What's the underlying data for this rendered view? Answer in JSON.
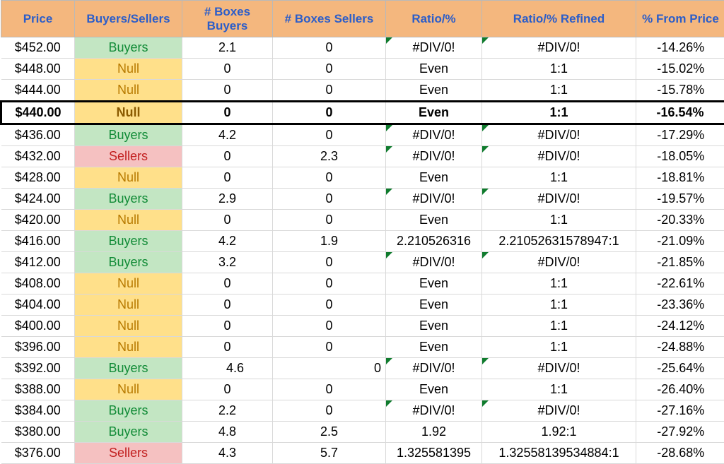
{
  "headers": {
    "price": "Price",
    "bs": "Buyers/Sellers",
    "boxes_buyers": "# Boxes Buyers",
    "boxes_sellers": "# Boxes Sellers",
    "ratio": "Ratio/%",
    "ratio_refined": "Ratio/% Refined",
    "pct_from_price": "% From Price"
  },
  "rows": [
    {
      "price": "$452.00",
      "bs": "Buyers",
      "bs_kind": "buyers",
      "bb": "2.1",
      "bsell": "0",
      "ratio": "#DIV/0!",
      "ratio_flag": true,
      "ratioref": "#DIV/0!",
      "ratioref_flag": true,
      "pct": "-14.26%",
      "hl": false
    },
    {
      "price": "$448.00",
      "bs": "Null",
      "bs_kind": "null",
      "bb": "0",
      "bsell": "0",
      "ratio": "Even",
      "ratio_flag": false,
      "ratioref": "1:1",
      "ratioref_flag": false,
      "pct": "-15.02%",
      "hl": false
    },
    {
      "price": "$444.00",
      "bs": "Null",
      "bs_kind": "null",
      "bb": "0",
      "bsell": "0",
      "ratio": "Even",
      "ratio_flag": false,
      "ratioref": "1:1",
      "ratioref_flag": false,
      "pct": "-15.78%",
      "hl": false
    },
    {
      "price": "$440.00",
      "bs": "Null",
      "bs_kind": "null",
      "bb": "0",
      "bsell": "0",
      "ratio": "Even",
      "ratio_flag": false,
      "ratioref": "1:1",
      "ratioref_flag": false,
      "pct": "-16.54%",
      "hl": true
    },
    {
      "price": "$436.00",
      "bs": "Buyers",
      "bs_kind": "buyers",
      "bb": "4.2",
      "bsell": "0",
      "ratio": "#DIV/0!",
      "ratio_flag": true,
      "ratioref": "#DIV/0!",
      "ratioref_flag": true,
      "pct": "-17.29%",
      "hl": false
    },
    {
      "price": "$432.00",
      "bs": "Sellers",
      "bs_kind": "sellers",
      "bb": "0",
      "bsell": "2.3",
      "ratio": "#DIV/0!",
      "ratio_flag": true,
      "ratioref": "#DIV/0!",
      "ratioref_flag": true,
      "pct": "-18.05%",
      "hl": false
    },
    {
      "price": "$428.00",
      "bs": "Null",
      "bs_kind": "null",
      "bb": "0",
      "bsell": "0",
      "ratio": "Even",
      "ratio_flag": false,
      "ratioref": "1:1",
      "ratioref_flag": false,
      "pct": "-18.81%",
      "hl": false
    },
    {
      "price": "$424.00",
      "bs": "Buyers",
      "bs_kind": "buyers",
      "bb": "2.9",
      "bsell": "0",
      "ratio": "#DIV/0!",
      "ratio_flag": true,
      "ratioref": "#DIV/0!",
      "ratioref_flag": true,
      "pct": "-19.57%",
      "hl": false
    },
    {
      "price": "$420.00",
      "bs": "Null",
      "bs_kind": "null",
      "bb": "0",
      "bsell": "0",
      "ratio": "Even",
      "ratio_flag": false,
      "ratioref": "1:1",
      "ratioref_flag": false,
      "pct": "-20.33%",
      "hl": false
    },
    {
      "price": "$416.00",
      "bs": "Buyers",
      "bs_kind": "buyers",
      "bb": "4.2",
      "bsell": "1.9",
      "ratio": "2.210526316",
      "ratio_flag": false,
      "ratioref": "2.21052631578947:1",
      "ratioref_flag": false,
      "pct": "-21.09%",
      "hl": false
    },
    {
      "price": "$412.00",
      "bs": "Buyers",
      "bs_kind": "buyers",
      "bb": "3.2",
      "bsell": "0",
      "ratio": "#DIV/0!",
      "ratio_flag": true,
      "ratioref": "#DIV/0!",
      "ratioref_flag": true,
      "pct": "-21.85%",
      "hl": false
    },
    {
      "price": "$408.00",
      "bs": "Null",
      "bs_kind": "null",
      "bb": "0",
      "bsell": "0",
      "ratio": "Even",
      "ratio_flag": false,
      "ratioref": "1:1",
      "ratioref_flag": false,
      "pct": "-22.61%",
      "hl": false
    },
    {
      "price": "$404.00",
      "bs": "Null",
      "bs_kind": "null",
      "bb": "0",
      "bsell": "0",
      "ratio": "Even",
      "ratio_flag": false,
      "ratioref": "1:1",
      "ratioref_flag": false,
      "pct": "-23.36%",
      "hl": false
    },
    {
      "price": "$400.00",
      "bs": "Null",
      "bs_kind": "null",
      "bb": "0",
      "bsell": "0",
      "ratio": "Even",
      "ratio_flag": false,
      "ratioref": "1:1",
      "ratioref_flag": false,
      "pct": "-24.12%",
      "hl": false
    },
    {
      "price": "$396.00",
      "bs": "Null",
      "bs_kind": "null",
      "bb": "0",
      "bsell": "0",
      "ratio": "Even",
      "ratio_flag": false,
      "ratioref": "1:1",
      "ratioref_flag": false,
      "pct": "-24.88%",
      "hl": false
    },
    {
      "price": "$392.00",
      "bs": "Buyers",
      "bs_kind": "buyers",
      "bb": "4.6",
      "bsell": "0",
      "ratio": "#DIV/0!",
      "ratio_flag": true,
      "ratioref": "#DIV/0!",
      "ratioref_flag": true,
      "pct": "-25.64%",
      "hl": false,
      "wide": true
    },
    {
      "price": "$388.00",
      "bs": "Null",
      "bs_kind": "null",
      "bb": "0",
      "bsell": "0",
      "ratio": "Even",
      "ratio_flag": false,
      "ratioref": "1:1",
      "ratioref_flag": false,
      "pct": "-26.40%",
      "hl": false
    },
    {
      "price": "$384.00",
      "bs": "Buyers",
      "bs_kind": "buyers",
      "bb": "2.2",
      "bsell": "0",
      "ratio": "#DIV/0!",
      "ratio_flag": true,
      "ratioref": "#DIV/0!",
      "ratioref_flag": true,
      "pct": "-27.16%",
      "hl": false
    },
    {
      "price": "$380.00",
      "bs": "Buyers",
      "bs_kind": "buyers",
      "bb": "4.8",
      "bsell": "2.5",
      "ratio": "1.92",
      "ratio_flag": false,
      "ratioref": "1.92:1",
      "ratioref_flag": false,
      "pct": "-27.92%",
      "hl": false
    },
    {
      "price": "$376.00",
      "bs": "Sellers",
      "bs_kind": "sellers",
      "bb": "4.3",
      "bsell": "5.7",
      "ratio": "1.325581395",
      "ratio_flag": false,
      "ratioref": "1.32558139534884:1",
      "ratioref_flag": false,
      "pct": "-28.68%",
      "hl": false
    }
  ]
}
